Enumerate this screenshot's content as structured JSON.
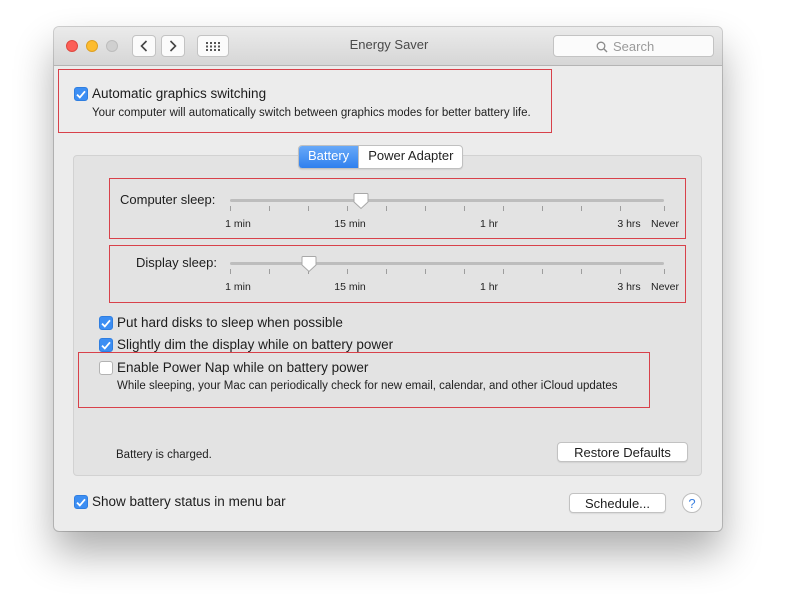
{
  "window": {
    "title": "Energy Saver",
    "search_placeholder": "Search"
  },
  "graphics": {
    "checked": true,
    "label": "Automatic graphics switching",
    "description": "Your computer will automatically switch between graphics modes for better battery life."
  },
  "tabs": [
    {
      "label": "Battery",
      "active": true
    },
    {
      "label": "Power Adapter",
      "active": false
    }
  ],
  "computer_sleep": {
    "label": "Computer sleep:",
    "value": "8 min",
    "tick_labels": [
      "1 min",
      "15 min",
      "1 hr",
      "3 hrs",
      "Never"
    ]
  },
  "display_sleep": {
    "label": "Display sleep:",
    "value": "5 min",
    "tick_labels": [
      "1 min",
      "15 min",
      "1 hr",
      "3 hrs",
      "Never"
    ]
  },
  "options": [
    {
      "label": "Put hard disks to sleep when possible",
      "checked": true
    },
    {
      "label": "Slightly dim the display while on battery power",
      "checked": true
    }
  ],
  "power_nap": {
    "checked": false,
    "label": "Enable Power Nap while on battery power",
    "description": "While sleeping, your Mac can periodically check for new email, calendar, and other iCloud updates"
  },
  "status_text": "Battery is charged.",
  "restore_defaults_label": "Restore Defaults",
  "show_battery_status": {
    "label": "Show battery status in menu bar",
    "checked": true
  },
  "schedule_label": "Schedule...",
  "help_label": "?",
  "colors": {
    "accent": "#3c8ef3",
    "highlight_box": "#d8414a"
  },
  "icons": [
    "back-chevron-icon",
    "forward-chevron-icon",
    "grid-icon",
    "search-icon",
    "checkmark-icon"
  ]
}
